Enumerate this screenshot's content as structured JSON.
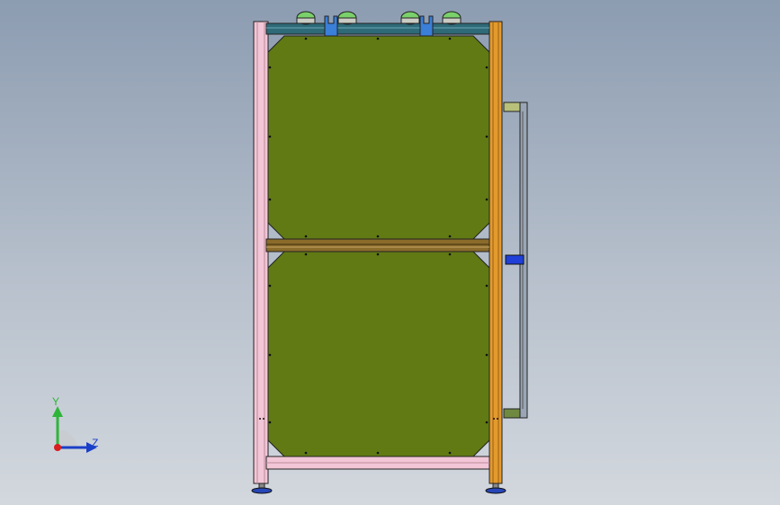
{
  "viewport": {
    "background_top": "#8c9cb1",
    "background_bottom": "#d3d8de"
  },
  "triad": {
    "y_label": "Y",
    "z_label": "Z",
    "y_color": "#2fb53a",
    "z_color": "#1a3fc8",
    "origin_color": "#d81e1e"
  },
  "model": {
    "panel_color": "#617a14",
    "left_post_color": "#f2c6d6",
    "right_post_color": "#e39a2e",
    "crossbar_color": "#8a6b2a",
    "top_rail_color": "#2e6a78",
    "handle_color": "#7c9a3a",
    "bracket_color": "#1f56c8",
    "button_cap_color": "#7ad06a"
  }
}
